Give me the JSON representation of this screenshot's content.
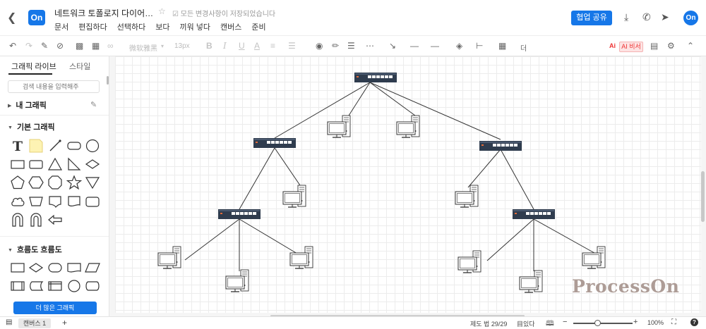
{
  "header": {
    "back_icon": "chevron-left-icon",
    "logo": "On",
    "title": "네트워크 토폴로지 다이어…",
    "save_status": "모든 변경사항이 저장되었습니다",
    "menu": [
      "문서",
      "편집하다",
      "선택하다",
      "보다",
      "끼워 넣다",
      "캔버스",
      "준비"
    ],
    "share_label": "협업 공유",
    "avatar": "On",
    "accent_color": "#1677e8"
  },
  "toolbar": {
    "font": "微软雅黑",
    "font_size": "13px",
    "arrange_label": "더",
    "ai_badge": "Ai",
    "ai_button": "AI 비서"
  },
  "sidebar": {
    "tabs": [
      "그래픽 라이브",
      "스타일"
    ],
    "search_placeholder": "검색 내용을 입력해주",
    "sections": {
      "my": "내 그래픽",
      "basic": "기본 그래픽",
      "flow": "흐름도 흐름도"
    },
    "more_button": "더 많은 그래픽"
  },
  "canvas": {
    "watermark": "ProcessOn"
  },
  "statusbar": {
    "canvas_tab": "캔버스 1",
    "add": "+",
    "limit": "제도 법 29/29",
    "lang": "目있다",
    "zoom_minus": "−",
    "zoom_plus": "+",
    "zoom": "100%",
    "help": "?"
  }
}
